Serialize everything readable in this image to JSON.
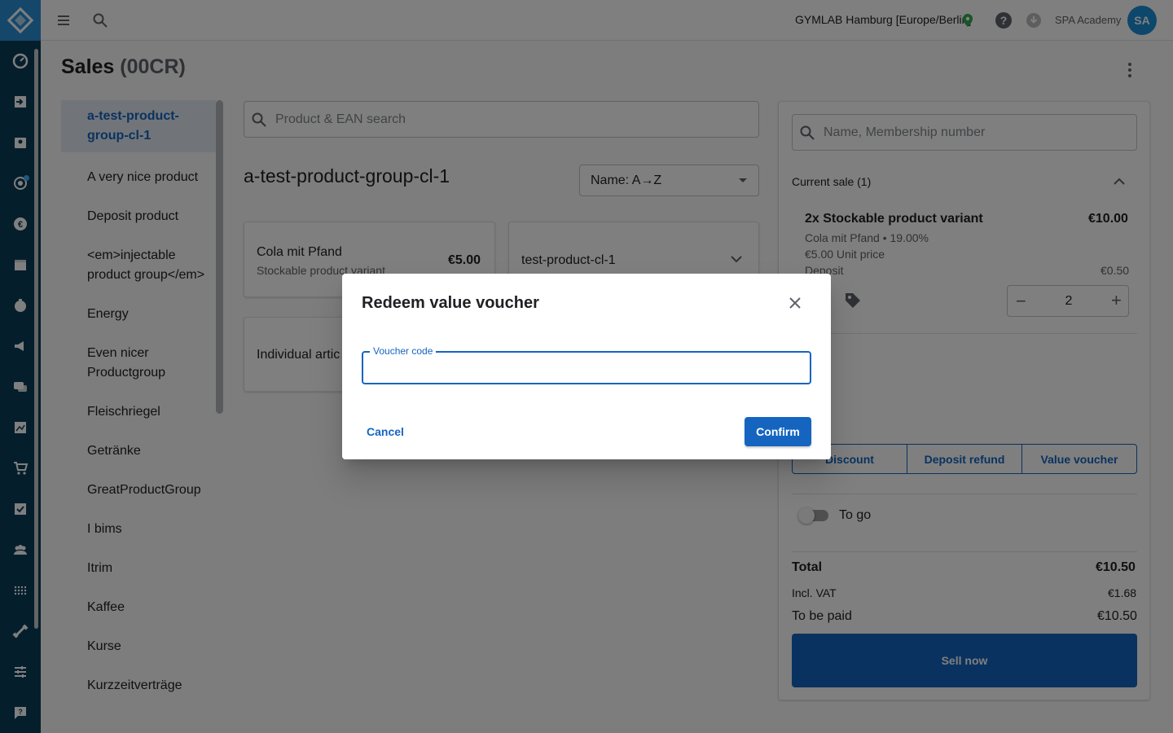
{
  "topbar": {
    "location": "GYMLAB Hamburg [Europe/Berlin]",
    "user_name": "SPA Academy",
    "avatar_initials": "SA"
  },
  "page": {
    "title": "Sales",
    "code": "(00CR)"
  },
  "product_groups": [
    {
      "label": "a-test-product-group-cl-1",
      "active": true
    },
    {
      "label": "A very nice product"
    },
    {
      "label": "Deposit product"
    },
    {
      "label": "<em>injectable product group</em>"
    },
    {
      "label": "Energy"
    },
    {
      "label": "Even nicer Productgroup"
    },
    {
      "label": "Fleischriegel"
    },
    {
      "label": "Getränke"
    },
    {
      "label": "GreatProductGroup"
    },
    {
      "label": "I bims"
    },
    {
      "label": "Itrim"
    },
    {
      "label": "Kaffee"
    },
    {
      "label": "Kurse"
    },
    {
      "label": "Kurzzeitverträge"
    }
  ],
  "products": {
    "search_placeholder": "Product & EAN search",
    "group_title": "a-test-product-group-cl-1",
    "sort_label": "Name: A→Z",
    "cards": [
      {
        "title": "Cola mit Pfand",
        "subtitle": "Stockable product variant",
        "price": "€5.00"
      },
      {
        "title": "test-product-cl-1"
      },
      {
        "title": "Individual artic"
      }
    ]
  },
  "sale": {
    "member_search_placeholder": "Name, Membership number",
    "header": "Current sale (1)",
    "item": {
      "title": "2x Stockable product variant",
      "price": "€10.00",
      "line1": "Cola mit Pfand • 19.00%",
      "line2": "€5.00 Unit price",
      "deposit_label": "Deposit",
      "deposit_value": "€0.50",
      "quantity": "2"
    },
    "actions": [
      "Discount",
      "Deposit refund",
      "Value voucher"
    ],
    "to_go_label": "To go",
    "total_label": "Total",
    "total_value": "€10.50",
    "vat_label": "Incl. VAT",
    "vat_value": "€1.68",
    "to_pay_label": "To be paid",
    "to_pay_value": "€10.50",
    "sell_label": "Sell now"
  },
  "dialog": {
    "title": "Redeem value voucher",
    "field_label": "Voucher code",
    "field_value": "",
    "cancel_label": "Cancel",
    "confirm_label": "Confirm"
  },
  "colors": {
    "primary": "#1565c0",
    "rail": "#0a3d58",
    "logo": "#2b8fd4",
    "avatar": "#1a8fd6",
    "location_pin": "#34a853"
  }
}
